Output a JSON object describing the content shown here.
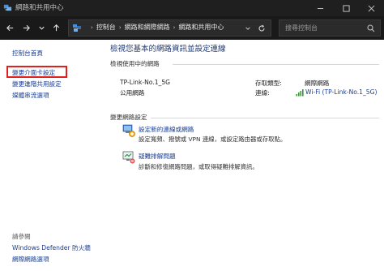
{
  "window": {
    "title": "網路和共用中心",
    "controls": [
      "minimize-icon",
      "maximize-icon",
      "close-icon"
    ]
  },
  "nav": {
    "breadcrumbs": [
      "控制台",
      "網路和網際網路",
      "網路和共用中心"
    ],
    "search_placeholder": "搜尋控制台"
  },
  "sidebar": {
    "items": [
      {
        "label": "控制台首頁"
      },
      {
        "label": "變更介面卡設定"
      },
      {
        "label": "變更進階共用設定"
      },
      {
        "label": "媒體串流選項"
      }
    ],
    "see_also_label": "請參閱",
    "see_also": [
      {
        "label": "Windows Defender 防火牆"
      },
      {
        "label": "網際網路選項"
      }
    ]
  },
  "main": {
    "heading": "檢視您基本的網路資訊並設定連線",
    "active_networks_label": "檢視使用中的網路",
    "network": {
      "name": "TP-Link-No.1_5G",
      "type": "公用網路",
      "access_type_label": "存取類型:",
      "access_type_value": "網際網路",
      "connections_label": "連線:",
      "connection_value": "Wi-Fi (TP-Link-No.1_5G)"
    },
    "change_settings_label": "變更網路設定",
    "actions": [
      {
        "title": "設定新的連線或網路",
        "description": "設定寬頻、撥號或 VPN 連線，或設定路由器或存取點。"
      },
      {
        "title": "疑難排解問題",
        "description": "診斷和修復網路問題，或取得疑難排解資訊。"
      }
    ]
  },
  "colors": {
    "titlebar_bg": "#1f1f1f",
    "navbar_bg": "#191919",
    "link": "#1a3d8f",
    "highlight_border": "#e0201c",
    "wifi_green": "#2f9a2f"
  }
}
